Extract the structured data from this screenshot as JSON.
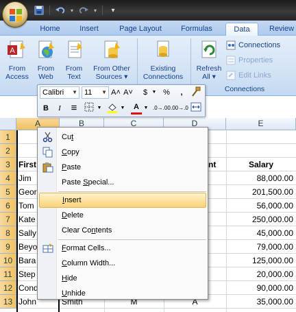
{
  "quick_access": {
    "undo_icon": "undo-icon",
    "redo_icon": "redo-icon",
    "save_icon": "save-icon",
    "customize_icon": "chevron-down-icon"
  },
  "tabs": [
    {
      "label": "Home"
    },
    {
      "label": "Insert"
    },
    {
      "label": "Page Layout"
    },
    {
      "label": "Formulas"
    },
    {
      "label": "Data"
    },
    {
      "label": "Review"
    }
  ],
  "ribbon": {
    "get_external": {
      "from_access": {
        "line1": "From",
        "line2": "Access"
      },
      "from_web": {
        "line1": "From",
        "line2": "Web"
      },
      "from_text": {
        "line1": "From",
        "line2": "Text"
      },
      "from_other": {
        "line1": "From Other",
        "line2": "Sources ▾"
      },
      "existing": {
        "line1": "Existing",
        "line2": "Connections"
      }
    },
    "connections": {
      "refresh": {
        "line1": "Refresh",
        "line2": "All ▾"
      },
      "connections_label": "Connections",
      "properties_label": "Properties",
      "edit_links_label": "Edit Links",
      "group_label": "Connections"
    }
  },
  "mini_toolbar": {
    "font": "Calibri",
    "size": "11",
    "grow": "A˄",
    "shrink": "A˅",
    "currency": "$",
    "percent": "%",
    "comma": ",",
    "bold": "B",
    "italic": "I",
    "align": "≡",
    "font_color_letter": "A",
    "inc_decimal": ".0→.00",
    "dec_decimal": ".00→.0"
  },
  "columns": [
    "A",
    "B",
    "C",
    "D",
    "E"
  ],
  "rows": [
    "1",
    "2",
    "3",
    "4",
    "5",
    "6",
    "7",
    "8",
    "9",
    "10",
    "11",
    "12",
    "13"
  ],
  "cells": {
    "a3": "First",
    "a4": "Jim",
    "a5": "Geor",
    "a6": "Tom",
    "a7": "Kate",
    "a8": "Sally",
    "a9": "Beyo",
    "a10": "Bara",
    "a11": "Step",
    "a12": "Cond",
    "a13": "John",
    "b13": "Smith",
    "c13": "M",
    "d3": "nt",
    "d13": "A",
    "e3": "Salary",
    "e4": "88,000.00",
    "e5": "201,500.00",
    "e6": "56,000.00",
    "e7": "250,000.00",
    "e8": "45,000.00",
    "e9": "79,000.00",
    "e10": "125,000.00",
    "e11": "20,000.00",
    "e12": "90,000.00",
    "e13": "35,000.00"
  },
  "context_menu": {
    "cut": {
      "pre": "Cu",
      "acc": "t",
      "post": ""
    },
    "copy": {
      "pre": "",
      "acc": "C",
      "post": "opy"
    },
    "paste": {
      "pre": "",
      "acc": "P",
      "post": "aste"
    },
    "paste_special": {
      "pre": "Paste ",
      "acc": "S",
      "post": "pecial..."
    },
    "insert": {
      "pre": "",
      "acc": "I",
      "post": "nsert"
    },
    "delete": {
      "pre": "",
      "acc": "D",
      "post": "elete"
    },
    "clear": {
      "pre": "Clear Co",
      "acc": "n",
      "post": "tents"
    },
    "format": {
      "pre": "",
      "acc": "F",
      "post": "ormat Cells..."
    },
    "width": {
      "pre": "",
      "acc": "C",
      "post": "olumn Width..."
    },
    "hide": {
      "pre": "",
      "acc": "H",
      "post": "ide"
    },
    "unhide": {
      "pre": "",
      "acc": "U",
      "post": "nhide"
    }
  },
  "colors": {
    "accent": "#15428b",
    "highlight": "#fbd27a",
    "header_selected": "#f1c15f",
    "title_bar": "#262626"
  }
}
